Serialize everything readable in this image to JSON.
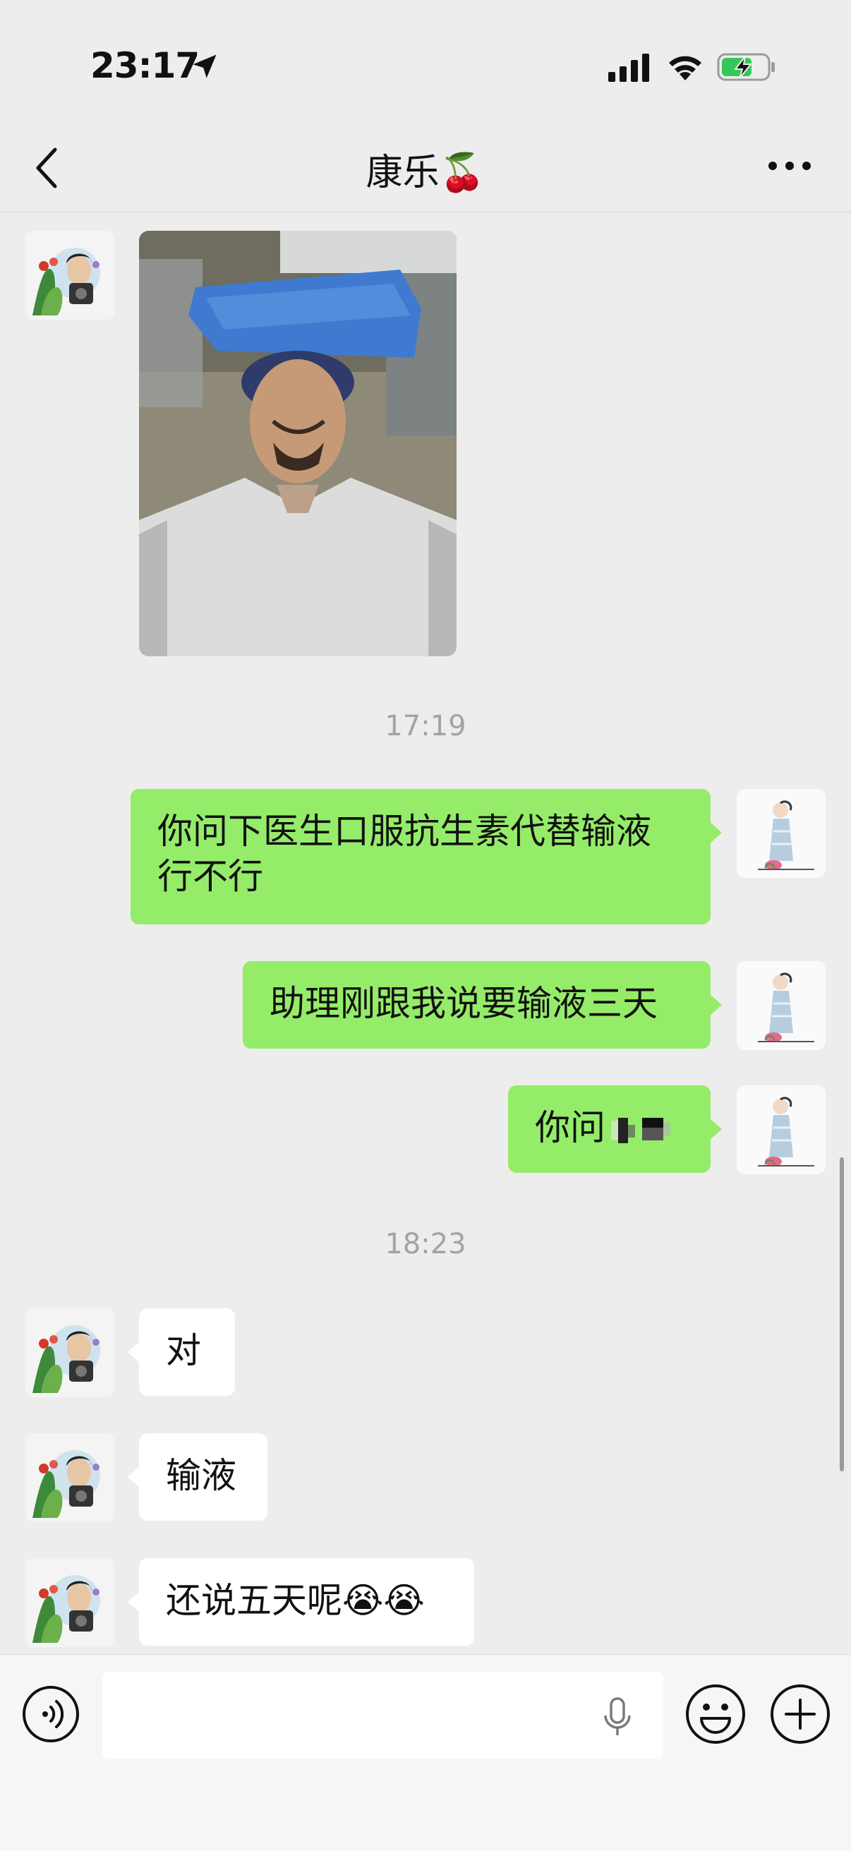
{
  "status_bar": {
    "time": "23:17",
    "location_icon": "location-arrow-icon",
    "signal_icon": "cellular-signal-icon",
    "wifi_icon": "wifi-icon",
    "battery_icon": "battery-charging-icon",
    "battery_color": "#34c759"
  },
  "header": {
    "back_icon": "chevron-left-icon",
    "title": "康乐🍒",
    "more_icon": "more-dots-icon"
  },
  "messages": [
    {
      "side": "in",
      "type": "image",
      "sender": "contact",
      "image": "photo-selfie-hospital"
    },
    {
      "type": "timestamp",
      "text": "17:19"
    },
    {
      "side": "out",
      "type": "text",
      "line1": "你问下医生口服抗生素代替输液",
      "line2": "行不行"
    },
    {
      "side": "out",
      "type": "text",
      "text": "助理刚跟我说要输液三天"
    },
    {
      "side": "out",
      "type": "text",
      "text": "你问",
      "note": "remaining text pixelated"
    },
    {
      "type": "timestamp",
      "text": "18:23"
    },
    {
      "side": "in",
      "type": "text",
      "text": "对"
    },
    {
      "side": "in",
      "type": "text",
      "text": "输液"
    },
    {
      "side": "in",
      "type": "text",
      "text": "还说五天呢😭😭"
    }
  ],
  "input_bar": {
    "voice_icon": "voice-mode-icon",
    "input_value": "",
    "mic_icon": "microphone-icon",
    "emoji_icon": "emoji-icon",
    "plus_icon": "plus-icon"
  },
  "colors": {
    "background": "#ededed",
    "outgoing_bubble": "#95ec69",
    "incoming_bubble": "#ffffff",
    "timestamp": "#a3a3a3"
  }
}
